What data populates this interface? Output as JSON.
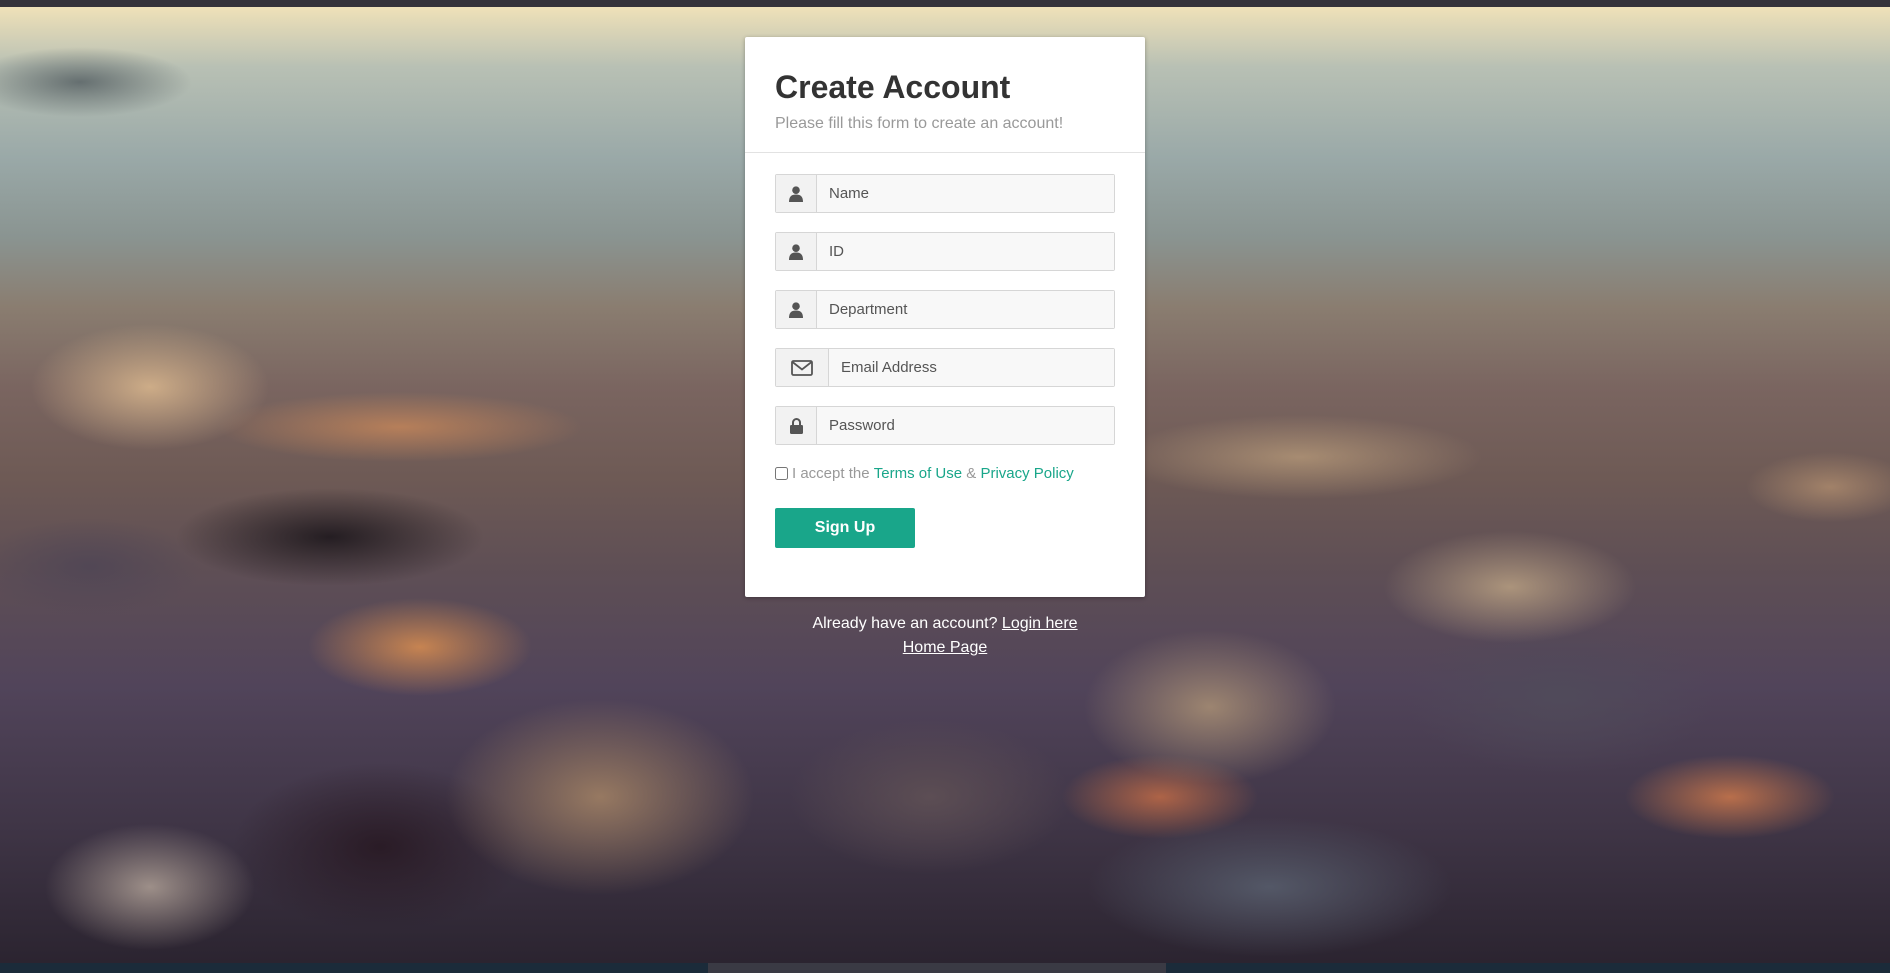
{
  "form": {
    "title": "Create Account",
    "subtitle": "Please fill this form to create an account!",
    "fields": [
      {
        "icon": "user-icon",
        "placeholder": "Name"
      },
      {
        "icon": "user-icon",
        "placeholder": "ID"
      },
      {
        "icon": "user-icon",
        "placeholder": "Department"
      },
      {
        "icon": "envelope-icon",
        "placeholder": "Email Address"
      },
      {
        "icon": "lock-icon",
        "placeholder": "Password"
      }
    ],
    "accept_prefix": "I accept the",
    "terms_link": "Terms of Use",
    "ampersand": "&",
    "privacy_link": "Privacy Policy",
    "signup_label": "Sign Up"
  },
  "footer": {
    "already_text": "Already have an account?",
    "login_link": "Login here",
    "home_link": "Home Page"
  },
  "colors": {
    "accent": "#19a68a",
    "title": "#333333",
    "muted": "#999999"
  }
}
